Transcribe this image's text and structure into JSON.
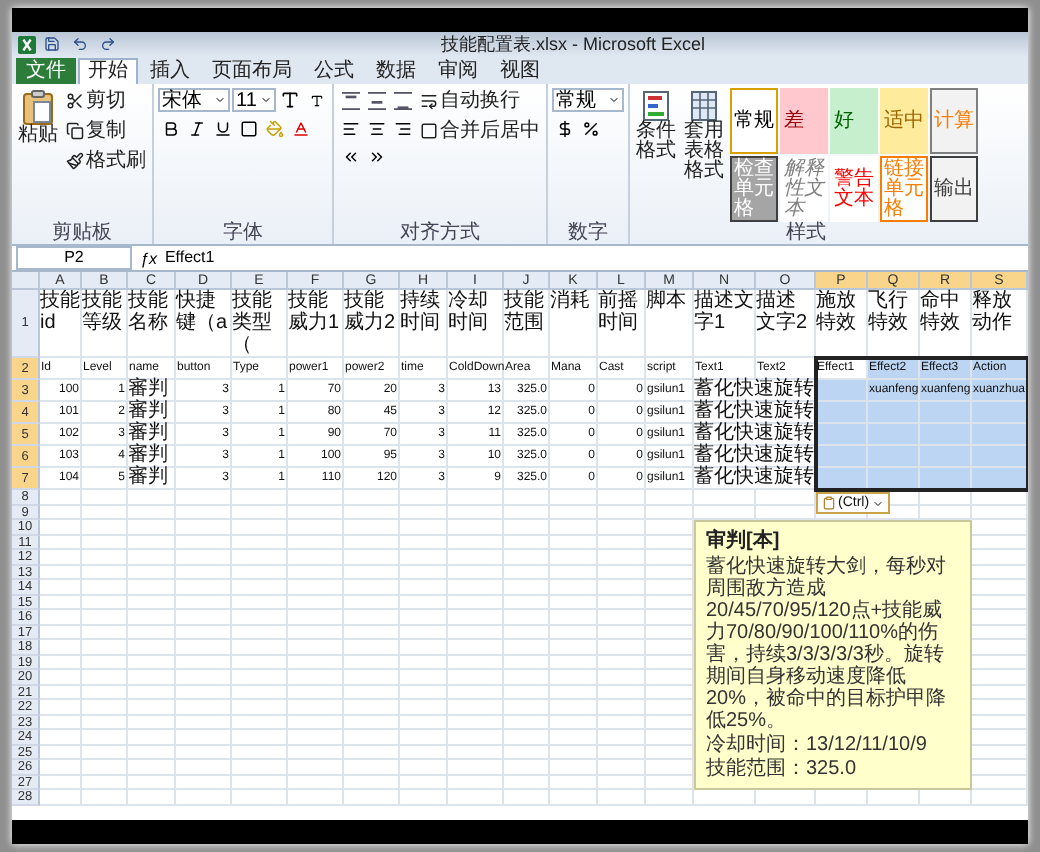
{
  "title_bar": {
    "title": "技能配置表.xlsx - Microsoft Excel"
  },
  "menu_tabs": [
    {
      "label": "文件",
      "kind": "file",
      "selected": false
    },
    {
      "label": "开始",
      "kind": "tab",
      "selected": true
    },
    {
      "label": "插入",
      "kind": "tab",
      "selected": false
    },
    {
      "label": "页面布局",
      "kind": "tab",
      "selected": false
    },
    {
      "label": "公式",
      "kind": "tab",
      "selected": false
    },
    {
      "label": "数据",
      "kind": "tab",
      "selected": false
    },
    {
      "label": "审阅",
      "kind": "tab",
      "selected": false
    },
    {
      "label": "视图",
      "kind": "tab",
      "selected": false
    }
  ],
  "ribbon": {
    "clipboard": {
      "label": "剪贴板",
      "paste": "粘贴",
      "cut": "剪切",
      "copy": "复制",
      "format_painter": "格式刷"
    },
    "font": {
      "label": "字体",
      "font_name": "宋体",
      "font_size": "11"
    },
    "alignment": {
      "label": "对齐方式",
      "wrap_text": "自动换行",
      "merge_center": "合并后居中"
    },
    "number": {
      "label": "数字",
      "format": "常规"
    },
    "styles": {
      "label": "样式",
      "conditional_formatting": "条件格式",
      "format_as_table": "套用表格格式",
      "cell_styles": [
        {
          "label": "常规",
          "kind": "normal"
        },
        {
          "label": "差",
          "kind": "bad"
        },
        {
          "label": "好",
          "kind": "good"
        },
        {
          "label": "适中",
          "kind": "neutral"
        },
        {
          "label": "计算",
          "kind": "calculation"
        },
        {
          "label": "检查单元格",
          "kind": "check"
        },
        {
          "label": "解释性文本",
          "kind": "explanatory"
        },
        {
          "label": "警告文本",
          "kind": "warning"
        },
        {
          "label": "链接单元格",
          "kind": "linked"
        },
        {
          "label": "输出",
          "kind": "output"
        }
      ]
    }
  },
  "formula_bar": {
    "name_box": "P2",
    "function_label": "ƒx",
    "value": "Effect1"
  },
  "sheet": {
    "columns": [
      {
        "label": "A",
        "selected": false
      },
      {
        "label": "B",
        "selected": false
      },
      {
        "label": "C",
        "selected": false
      },
      {
        "label": "D",
        "selected": false
      },
      {
        "label": "E",
        "selected": false
      },
      {
        "label": "F",
        "selected": false
      },
      {
        "label": "G",
        "selected": false
      },
      {
        "label": "H",
        "selected": false
      },
      {
        "label": "I",
        "selected": false
      },
      {
        "label": "J",
        "selected": false
      },
      {
        "label": "K",
        "selected": false
      },
      {
        "label": "L",
        "selected": false
      },
      {
        "label": "M",
        "selected": false
      },
      {
        "label": "N",
        "selected": false
      },
      {
        "label": "O",
        "selected": false
      },
      {
        "label": "P",
        "selected": true
      },
      {
        "label": "Q",
        "selected": true
      },
      {
        "label": "R",
        "selected": true
      },
      {
        "label": "S",
        "selected": true
      }
    ],
    "rows": [
      {
        "number": "1",
        "selected": false,
        "cells": [
          "技能id",
          "技能等级",
          "技能名称",
          "快捷键（a",
          "技能类型（",
          "技能威力1",
          "技能威力2",
          "持续时间",
          "冷却时间",
          "技能范围",
          "消耗",
          "前摇时间",
          "脚本",
          "描述文字1",
          "描述文字2",
          "施放特效",
          "飞行特效",
          "命中特效",
          "释放动作"
        ]
      },
      {
        "number": "2",
        "selected": true,
        "cells": [
          "Id",
          "Level",
          "name",
          "button",
          "Type",
          "power1",
          "power2",
          "time",
          "ColdDown",
          "Area",
          "Mana",
          "Cast",
          "script",
          "Text1",
          "Text2",
          "Effect1",
          "Effect2",
          "Effect3",
          "Action"
        ]
      },
      {
        "number": "3",
        "selected": true,
        "cells": [
          "100",
          "1",
          "審判",
          "3",
          "1",
          "70",
          "20",
          "3",
          "13",
          "325.0",
          "0",
          "0",
          "gsilun1",
          "蓄化快速旋转",
          "",
          "",
          "xuanfeng",
          "xuanfeng",
          "xuanzhua"
        ]
      },
      {
        "number": "4",
        "selected": true,
        "cells": [
          "101",
          "2",
          "審判",
          "3",
          "1",
          "80",
          "45",
          "3",
          "12",
          "325.0",
          "0",
          "0",
          "gsilun1",
          "蓄化快速旋转",
          "",
          "",
          "",
          "",
          ""
        ]
      },
      {
        "number": "5",
        "selected": true,
        "cells": [
          "102",
          "3",
          "審判",
          "3",
          "1",
          "90",
          "70",
          "3",
          "11",
          "325.0",
          "0",
          "0",
          "gsilun1",
          "蓄化快速旋转",
          "",
          "",
          "",
          "",
          ""
        ]
      },
      {
        "number": "6",
        "selected": true,
        "cells": [
          "103",
          "4",
          "審判",
          "3",
          "1",
          "100",
          "95",
          "3",
          "10",
          "325.0",
          "0",
          "0",
          "gsilun1",
          "蓄化快速旋转",
          "",
          "",
          "",
          "",
          ""
        ]
      },
      {
        "number": "7",
        "selected": true,
        "cells": [
          "104",
          "5",
          "審判",
          "3",
          "1",
          "110",
          "120",
          "3",
          "9",
          "325.0",
          "0",
          "0",
          "gsilun1",
          "蓄化快速旋转",
          "",
          "",
          "",
          "",
          ""
        ]
      },
      {
        "number": "8",
        "selected": false,
        "cells": []
      },
      {
        "number": "9",
        "selected": false,
        "cells": []
      },
      {
        "number": "10",
        "selected": false,
        "cells": []
      },
      {
        "number": "11",
        "selected": false,
        "cells": []
      },
      {
        "number": "12",
        "selected": false,
        "cells": []
      },
      {
        "number": "13",
        "selected": false,
        "cells": []
      },
      {
        "number": "14",
        "selected": false,
        "cells": []
      },
      {
        "number": "15",
        "selected": false,
        "cells": []
      },
      {
        "number": "16",
        "selected": false,
        "cells": []
      },
      {
        "number": "17",
        "selected": false,
        "cells": []
      },
      {
        "number": "18",
        "selected": false,
        "cells": []
      },
      {
        "number": "19",
        "selected": false,
        "cells": []
      },
      {
        "number": "20",
        "selected": false,
        "cells": []
      },
      {
        "number": "21",
        "selected": false,
        "cells": []
      },
      {
        "number": "22",
        "selected": false,
        "cells": []
      },
      {
        "number": "23",
        "selected": false,
        "cells": []
      },
      {
        "number": "24",
        "selected": false,
        "cells": []
      },
      {
        "number": "25",
        "selected": false,
        "cells": []
      },
      {
        "number": "26",
        "selected": false,
        "cells": []
      },
      {
        "number": "27",
        "selected": false,
        "cells": []
      },
      {
        "number": "28",
        "selected": false,
        "cells": []
      }
    ],
    "paste_options": {
      "label": "(Ctrl)"
    },
    "comment": {
      "title": "审判[本]",
      "lines": [
        "蓄化快速旋转大剑，每秒对周围敌方造成20/45/70/95/120点+技能威力70/80/90/100/110%的伤害，持续3/3/3/3/3秒。旋转期间自身移动速度降低20%，被命中的目标护甲降低25%。",
        "冷却时间：13/12/11/10/9",
        "技能范围：325.0"
      ]
    }
  }
}
